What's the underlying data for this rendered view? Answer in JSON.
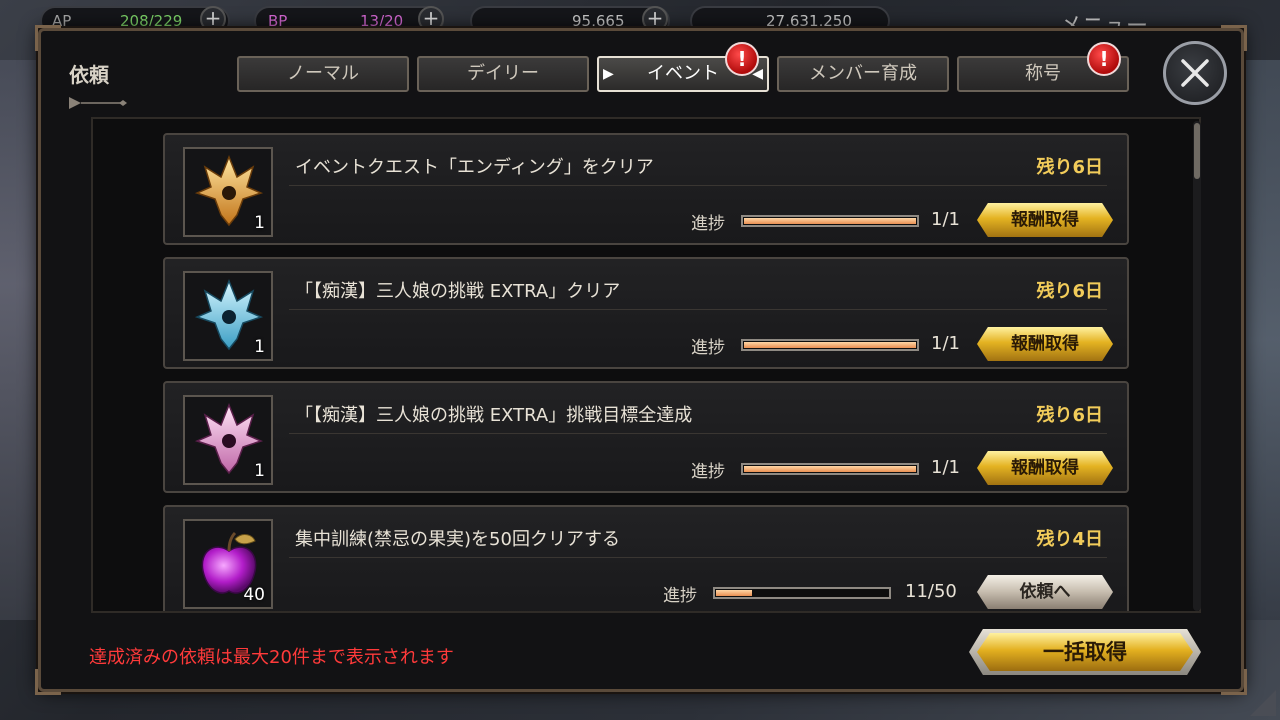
{
  "hud": {
    "ap_label": "AP",
    "ap_value": "208/229",
    "bp_label": "BP",
    "bp_value": "13/20",
    "currency1": "95,665",
    "currency2": "27,631,250",
    "menu_label": "メニュー"
  },
  "dialog": {
    "title": "依頼",
    "tabs": [
      {
        "label": "ノーマル",
        "active": false,
        "badge": ""
      },
      {
        "label": "デイリー",
        "active": false,
        "badge": ""
      },
      {
        "label": "イベント",
        "active": true,
        "badge": "!"
      },
      {
        "label": "メンバー育成",
        "active": false,
        "badge": ""
      },
      {
        "label": "称号",
        "active": false,
        "badge": "!"
      }
    ],
    "progress_label": "進捗",
    "quests": [
      {
        "title": "イベントクエスト「エンディング」をクリア",
        "remaining": "残り6日",
        "progress": "1/1",
        "progress_fraction": 1.0,
        "button": "報酬取得",
        "button_style": "gold",
        "icon": "gold-crest-icon",
        "icon_count": "1"
      },
      {
        "title": "「【痴漢】三人娘の挑戦 EXTRA」クリア",
        "remaining": "残り6日",
        "progress": "1/1",
        "progress_fraction": 1.0,
        "button": "報酬取得",
        "button_style": "gold",
        "icon": "blue-crest-icon",
        "icon_count": "1"
      },
      {
        "title": "「【痴漢】三人娘の挑戦 EXTRA」挑戦目標全達成",
        "remaining": "残り6日",
        "progress": "1/1",
        "progress_fraction": 1.0,
        "button": "報酬取得",
        "button_style": "gold",
        "icon": "pink-crest-icon",
        "icon_count": "1"
      },
      {
        "title": "集中訓練(禁忌の果実)を50回クリアする",
        "remaining": "残り4日",
        "progress": "11/50",
        "progress_fraction": 0.22,
        "button": "依頼へ",
        "button_style": "silver",
        "icon": "purple-apple-icon",
        "icon_count": "40"
      }
    ],
    "footer_note": "達成済みの依頼は最大20件まで表示されます",
    "bulk_button": "一括取得"
  },
  "colors": {
    "accent_gold": "#e4b322",
    "remaining_text": "#f2cc5a",
    "warning_text": "#ff3a3a",
    "badge_red": "#d41212",
    "progress_fill": "#e98f52"
  }
}
